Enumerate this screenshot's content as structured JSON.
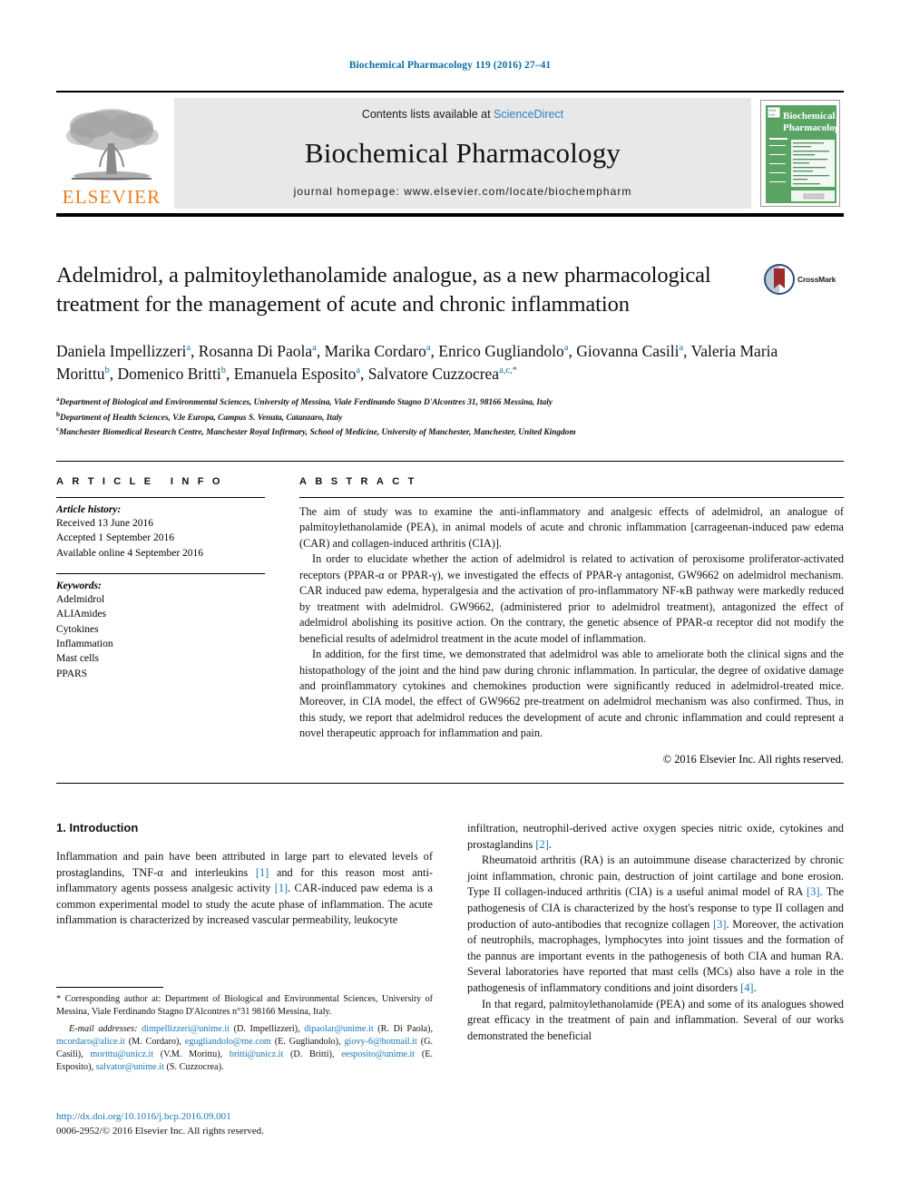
{
  "running_head": "Biochemical Pharmacology 119 (2016) 27–41",
  "masthead": {
    "publisher_name": "ELSEVIER",
    "contents_prefix": "Contents lists available at ",
    "contents_link": "ScienceDirect",
    "journal_title": "Biochemical Pharmacology",
    "homepage": "journal homepage: www.elsevier.com/locate/biochempharm",
    "cover_title_line1": "Biochemical",
    "cover_title_line2": "Pharmacology"
  },
  "article": {
    "title": "Adelmidrol, a palmitoylethanolamide analogue, as a new pharmacological treatment for the management of acute and chronic inflammation",
    "crossmark_label": "CrossMark",
    "authors": [
      {
        "name": "Daniela Impellizzeri",
        "sup": "a",
        "sep": ", "
      },
      {
        "name": "Rosanna Di Paola",
        "sup": "a",
        "sep": ", "
      },
      {
        "name": "Marika Cordaro",
        "sup": "a",
        "sep": ", "
      },
      {
        "name": "Enrico Gugliandolo",
        "sup": "a",
        "sep": ", "
      },
      {
        "name": "Giovanna Casili",
        "sup": "a",
        "sep": ", "
      },
      {
        "name": "Valeria Maria Morittu",
        "sup": "b",
        "sep": ", "
      },
      {
        "name": "Domenico Britti",
        "sup": "b",
        "sep": ", "
      },
      {
        "name": "Emanuela Esposito",
        "sup": "a",
        "sep": ", "
      },
      {
        "name": "Salvatore Cuzzocrea",
        "sup": "a,c,*",
        "sep": ""
      }
    ],
    "affiliations": [
      {
        "marker": "a",
        "text": "Department of Biological and Environmental Sciences, University of Messina, Viale Ferdinando Stagno D'Alcontres 31, 98166 Messina, Italy"
      },
      {
        "marker": "b",
        "text": "Department of Health Sciences, V.le Europa, Campus S. Venuta, Catanzaro, Italy"
      },
      {
        "marker": "c",
        "text": "Manchester Biomedical Research Centre, Manchester Royal Infirmary, School of Medicine, University of Manchester, Manchester, United Kingdom"
      }
    ]
  },
  "article_info": {
    "heading": "ARTICLE INFO",
    "history_title": "Article history:",
    "history": [
      "Received 13 June 2016",
      "Accepted 1 September 2016",
      "Available online 4 September 2016"
    ],
    "keywords_title": "Keywords:",
    "keywords": [
      "Adelmidrol",
      "ALIAmides",
      "Cytokines",
      "Inflammation",
      "Mast cells",
      "PPARS"
    ]
  },
  "abstract": {
    "heading": "ABSTRACT",
    "paragraphs": [
      "The aim of study was to examine the anti-inflammatory and analgesic effects of adelmidrol, an analogue of palmitoylethanolamide (PEA), in animal models of acute and chronic inflammation [carrageenan-induced paw edema (CAR) and collagen-induced arthritis (CIA)].",
      "In order to elucidate whether the action of adelmidrol is related to activation of peroxisome proliferator-activated receptors (PPAR-α or PPAR-γ), we investigated the effects of PPAR-γ antagonist, GW9662 on adelmidrol mechanism. CAR induced paw edema, hyperalgesia and the activation of pro-inflammatory NF-κB pathway were markedly reduced by treatment with adelmidrol. GW9662, (administered prior to adelmidrol treatment), antagonized the effect of adelmidrol abolishing its positive action. On the contrary, the genetic absence of PPAR-α receptor did not modify the beneficial results of adelmidrol treatment in the acute model of inflammation.",
      "In addition, for the first time, we demonstrated that adelmidrol was able to ameliorate both the clinical signs and the histopathology of the joint and the hind paw during chronic inflammation. In particular, the degree of oxidative damage and proinflammatory cytokines and chemokines production were significantly reduced in adelmidrol-treated mice. Moreover, in CIA model, the effect of GW9662 pre-treatment on adelmidrol mechanism was also confirmed. Thus, in this study, we report that adelmidrol reduces the development of acute and chronic inflammation and could represent a novel therapeutic approach for inflammation and pain."
    ],
    "copyright": "© 2016 Elsevier Inc. All rights reserved."
  },
  "introduction": {
    "section_title": "1. Introduction",
    "left_paragraphs": [
      {
        "runs": [
          {
            "t": "Inflammation and pain have been attributed in large part to elevated levels of prostaglandins, TNF-α and interleukins "
          },
          {
            "t": "[1]",
            "ref": true
          },
          {
            "t": " and for this reason most anti-inflammatory agents possess analgesic activity "
          },
          {
            "t": "[1]",
            "ref": true
          },
          {
            "t": ". CAR-induced paw edema is a common experimental model to study the acute phase of inflammation. The acute inflammation is characterized by increased vascular permeability, leukocyte"
          }
        ]
      }
    ],
    "right_paragraphs": [
      {
        "runs": [
          {
            "t": "infiltration, neutrophil-derived active oxygen species nitric oxide, cytokines and prostaglandins "
          },
          {
            "t": "[2]",
            "ref": true
          },
          {
            "t": "."
          }
        ]
      },
      {
        "runs": [
          {
            "t": "Rheumatoid arthritis (RA) is an autoimmune disease characterized by chronic joint inflammation, chronic pain, destruction of joint cartilage and bone erosion. Type II collagen-induced arthritis (CIA) is a useful animal model of RA "
          },
          {
            "t": "[3]",
            "ref": true
          },
          {
            "t": ". The pathogenesis of CIA is characterized by the host's response to type II collagen and production of auto-antibodies that recognize collagen "
          },
          {
            "t": "[3]",
            "ref": true
          },
          {
            "t": ". Moreover, the activation of neutrophils, macrophages, lymphocytes into joint tissues and the formation of the pannus are important events in the pathogenesis of both CIA and human RA. Several laboratories have reported that mast cells (MCs) also have a role in the pathogenesis of inflammatory conditions and joint disorders "
          },
          {
            "t": "[4]",
            "ref": true
          },
          {
            "t": "."
          }
        ]
      },
      {
        "runs": [
          {
            "t": "In that regard, palmitoylethanolamide (PEA) and some of its analogues showed great efficacy in the treatment of pain and inflammation. Several of our works demonstrated the beneficial"
          }
        ]
      }
    ]
  },
  "footnotes": {
    "corresponding": "* Corresponding author at: Department of Biological and Environmental Sciences, University of Messina, Viale Ferdinando Stagno D'Alcontres n°31 98166 Messina, Italy.",
    "email_label": "E-mail addresses:",
    "emails": [
      {
        "mail": "dimpellizzeri@unime.it",
        "who": " (D. Impellizzeri), "
      },
      {
        "mail": "dipaolar@unime.it",
        "who": " (R. Di Paola), "
      },
      {
        "mail": "mcordaro@alice.it",
        "who": " (M. Cordaro), "
      },
      {
        "mail": "egugliandolo@me.com",
        "who": " (E. Gugliandolo), "
      },
      {
        "mail": "giovy-6@hotmail.it",
        "who": " (G. Casili), "
      },
      {
        "mail": "morittu@unicz.it",
        "who": " (V.M. Morittu), "
      },
      {
        "mail": "britti@unicz.it",
        "who": " (D. Britti), "
      },
      {
        "mail": "eesposito@unime.it",
        "who": " (E. Esposito), "
      },
      {
        "mail": "salvator@unime.it",
        "who": " (S. Cuzzocrea)."
      }
    ],
    "doi": "http://dx.doi.org/10.1016/j.bcp.2016.09.001",
    "issn": "0006-2952/© 2016 Elsevier Inc. All rights reserved."
  },
  "colors": {
    "link_blue": "#1577b5",
    "header_blue": "#0b6ea8",
    "elsevier_orange": "#f07c1a",
    "cover_green": "#4e9a55",
    "crossmark_red": "#9e2a2b"
  }
}
